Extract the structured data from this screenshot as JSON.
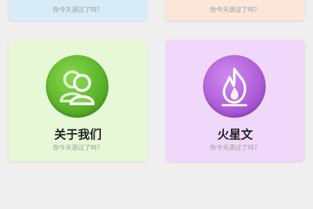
{
  "cards": [
    {
      "title": "",
      "subtitle": "你今天测过了吗？",
      "background": "#d8ecf7"
    },
    {
      "title": "",
      "subtitle": "你今天测过了吗？",
      "background": "#fbe6da"
    },
    {
      "title": "关于我们",
      "subtitle": "你今天测过了吗？",
      "background": "#e6f8d6",
      "icon": "users-icon",
      "icon_color": "#5cb52b"
    },
    {
      "title": "火星文",
      "subtitle": "你今天测过了吗？",
      "background": "#f0d8fa",
      "icon": "flame-icon",
      "icon_color": "#b05fd9"
    }
  ]
}
